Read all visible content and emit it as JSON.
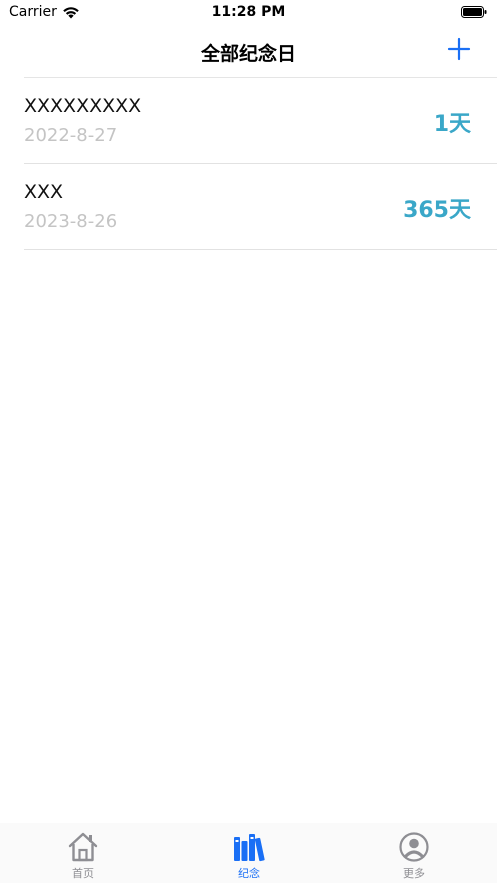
{
  "status_bar": {
    "carrier": "Carrier",
    "time": "11:28 PM"
  },
  "nav": {
    "title": "全部纪念日",
    "add_icon": "plus-icon"
  },
  "anniversaries": [
    {
      "title": "XXXXXXXXX",
      "date": "2022-8-27",
      "days": "1天"
    },
    {
      "title": "XXX",
      "date": "2023-8-26",
      "days": "365天"
    }
  ],
  "tabs": [
    {
      "label": "首页",
      "icon": "home-icon",
      "active": false
    },
    {
      "label": "纪念",
      "icon": "books-icon",
      "active": true
    },
    {
      "label": "更多",
      "icon": "person-circle-icon",
      "active": false
    }
  ],
  "colors": {
    "accent": "#1a6ff5",
    "days_text": "#3aa7c8",
    "date_text": "#c4c4c4",
    "tab_inactive": "#8e8e93"
  }
}
